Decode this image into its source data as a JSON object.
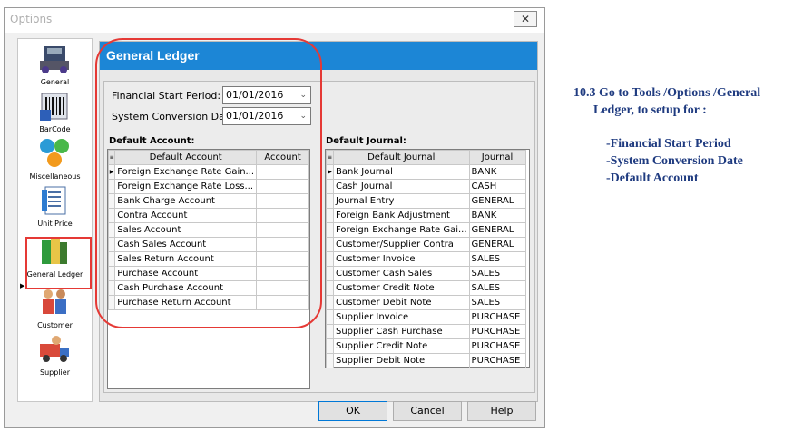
{
  "window": {
    "title": "Options",
    "close_glyph": "✕"
  },
  "sidebar": {
    "items": [
      {
        "label": "General",
        "icon": "general-icon"
      },
      {
        "label": "BarCode",
        "icon": "barcode-icon"
      },
      {
        "label": "Miscellaneous",
        "icon": "miscellaneous-icon"
      },
      {
        "label": "Unit Price",
        "icon": "unit-price-icon"
      },
      {
        "label": "General Ledger",
        "icon": "general-ledger-icon"
      },
      {
        "label": "Customer",
        "icon": "customer-icon"
      },
      {
        "label": "Supplier",
        "icon": "supplier-icon"
      }
    ],
    "selected": "General Ledger"
  },
  "panel": {
    "title": "General Ledger",
    "financial_start_label": "Financial Start Period:",
    "financial_start_value": "01/01/2016",
    "conversion_label": "System Conversion Date:",
    "conversion_value": "01/01/2016",
    "default_account_label": "Default Account:",
    "default_journal_label": "Default Journal:"
  },
  "account_grid": {
    "columns": [
      "Default Account",
      "Account"
    ],
    "rows": [
      {
        "name": "Foreign Exchange Rate Gain...",
        "account": ""
      },
      {
        "name": "Foreign Exchange Rate Loss...",
        "account": ""
      },
      {
        "name": "Bank Charge Account",
        "account": ""
      },
      {
        "name": "Contra Account",
        "account": ""
      },
      {
        "name": "Sales Account",
        "account": ""
      },
      {
        "name": "Cash Sales Account",
        "account": ""
      },
      {
        "name": "Sales Return Account",
        "account": ""
      },
      {
        "name": "Purchase Account",
        "account": ""
      },
      {
        "name": "Cash Purchase Account",
        "account": ""
      },
      {
        "name": "Purchase Return Account",
        "account": ""
      }
    ]
  },
  "journal_grid": {
    "columns": [
      "Default Journal",
      "Journal"
    ],
    "rows": [
      {
        "name": "Bank Journal",
        "journal": "BANK"
      },
      {
        "name": "Cash Journal",
        "journal": "CASH"
      },
      {
        "name": "Journal Entry",
        "journal": "GENERAL"
      },
      {
        "name": "Foreign Bank Adjustment",
        "journal": "BANK"
      },
      {
        "name": "Foreign Exchange Rate Gai...",
        "journal": "GENERAL"
      },
      {
        "name": "Customer/Supplier Contra",
        "journal": "GENERAL"
      },
      {
        "name": "Customer Invoice",
        "journal": "SALES"
      },
      {
        "name": "Customer Cash Sales",
        "journal": "SALES"
      },
      {
        "name": "Customer Credit Note",
        "journal": "SALES"
      },
      {
        "name": "Customer Debit Note",
        "journal": "SALES"
      },
      {
        "name": "Supplier Invoice",
        "journal": "PURCHASE"
      },
      {
        "name": "Supplier Cash Purchase",
        "journal": "PURCHASE"
      },
      {
        "name": "Supplier Credit Note",
        "journal": "PURCHASE"
      },
      {
        "name": "Supplier Debit Note",
        "journal": "PURCHASE"
      }
    ]
  },
  "buttons": {
    "ok": "OK",
    "cancel": "Cancel",
    "help": "Help"
  },
  "instructions": {
    "line1": "10.3 Go to Tools /Options /General",
    "line2": "Ledger, to setup for :",
    "items": [
      "-Financial Start Period",
      "-System Conversion Date",
      "-Default Account"
    ]
  },
  "colors": {
    "accent": "#1c86d6",
    "highlight": "#e53935",
    "instruction_text": "#1f3b80"
  }
}
